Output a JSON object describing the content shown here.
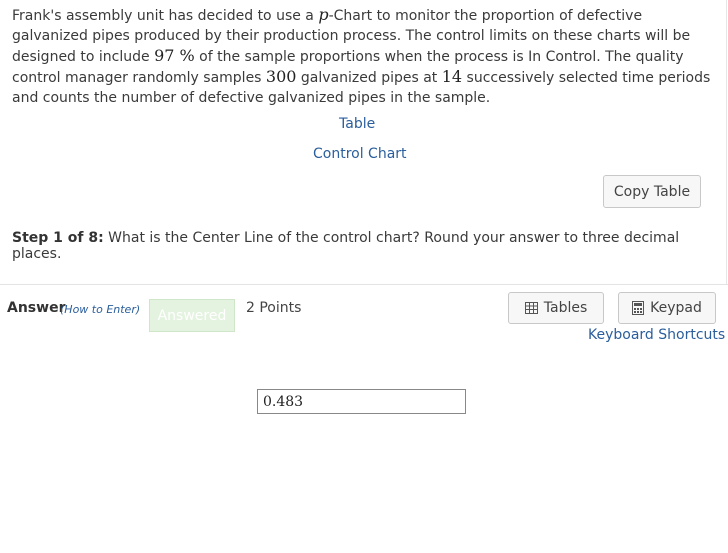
{
  "problem": {
    "t1": "Frank's assembly unit has decided to use a ",
    "p_var": "p",
    "t2": "-Chart to monitor the proportion of defective galvanized pipes produced by their production process. The control limits on these charts will be designed to include ",
    "pct_value": "97 %",
    "t3": " of the sample proportions when the process is In Control. The quality control manager randomly samples ",
    "sample_size": "300",
    "t4": " galvanized pipes at ",
    "periods": "14",
    "t5": " successively selected time periods and counts the number of defective galvanized pipes in the sample."
  },
  "links": {
    "table": "Table",
    "control_chart": "Control Chart"
  },
  "copy_table_label": "Copy Table",
  "step": {
    "prefix": "Step 1 of 8:",
    "text": " What is the Center Line of the control chart? Round your answer to three decimal places."
  },
  "answer": {
    "label": "Answer",
    "how_to": "(How to Enter)",
    "status": "Answered",
    "points": "2 Points",
    "value": "0.483"
  },
  "tools": {
    "tables_label": "Tables",
    "keypad_label": "Keypad",
    "shortcuts_label": "Keyboard Shortcuts"
  },
  "icons": {
    "tables": "table-grid-icon",
    "keypad": "calculator-icon"
  },
  "colors": {
    "link": "#2a5e9c",
    "answered_bg": "#e4f3e0"
  }
}
